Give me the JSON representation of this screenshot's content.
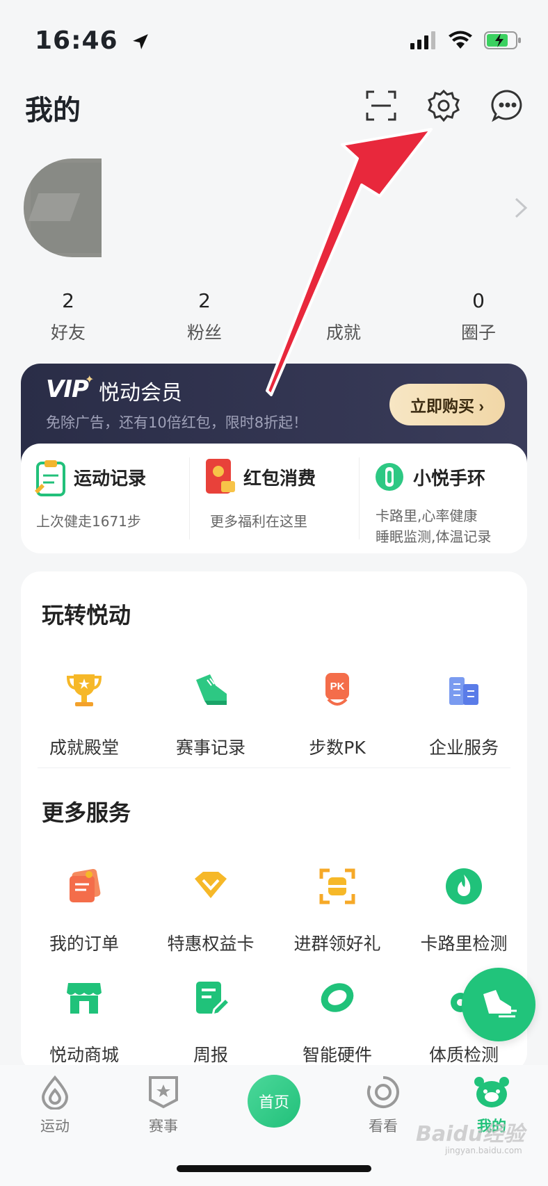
{
  "status_bar": {
    "time": "16:46"
  },
  "header": {
    "title": "我的"
  },
  "stats": [
    {
      "value": "2",
      "label": "好友"
    },
    {
      "value": "2",
      "label": "粉丝"
    },
    {
      "value": "",
      "label": "成就"
    },
    {
      "value": "0",
      "label": "圈子"
    }
  ],
  "vip": {
    "logo": "VIP",
    "title": "悦动会员",
    "subtitle": "免除广告，还有10倍红包，限时8折起！",
    "button": "立即购买 ›"
  },
  "quick": [
    {
      "title": "运动记录",
      "sub": "上次健走1671步"
    },
    {
      "title": "红包消费",
      "sub": "更多福利在这里"
    },
    {
      "title": "小悦手环",
      "sub1": "卡路里,心率健康",
      "sub2": "睡眠监测,体温记录"
    }
  ],
  "play": {
    "title": "玩转悦动",
    "items": [
      "成就殿堂",
      "赛事记录",
      "步数PK",
      "企业服务"
    ]
  },
  "more": {
    "title": "更多服务",
    "items": [
      "我的订单",
      "特惠权益卡",
      "进群领好礼",
      "卡路里检测",
      "悦动商城",
      "周报",
      "智能硬件",
      "体质检测"
    ]
  },
  "tabs": [
    {
      "label": "运动"
    },
    {
      "label": "赛事"
    },
    {
      "label": "首页"
    },
    {
      "label": "看看"
    },
    {
      "label": "我的"
    }
  ],
  "watermark": {
    "main": "Baidu经验",
    "sub": "jingyan.baidu.com"
  },
  "colors": {
    "accent": "#20c27a",
    "vip_bg": "#2a2d47",
    "arrow": "#e8283c"
  }
}
